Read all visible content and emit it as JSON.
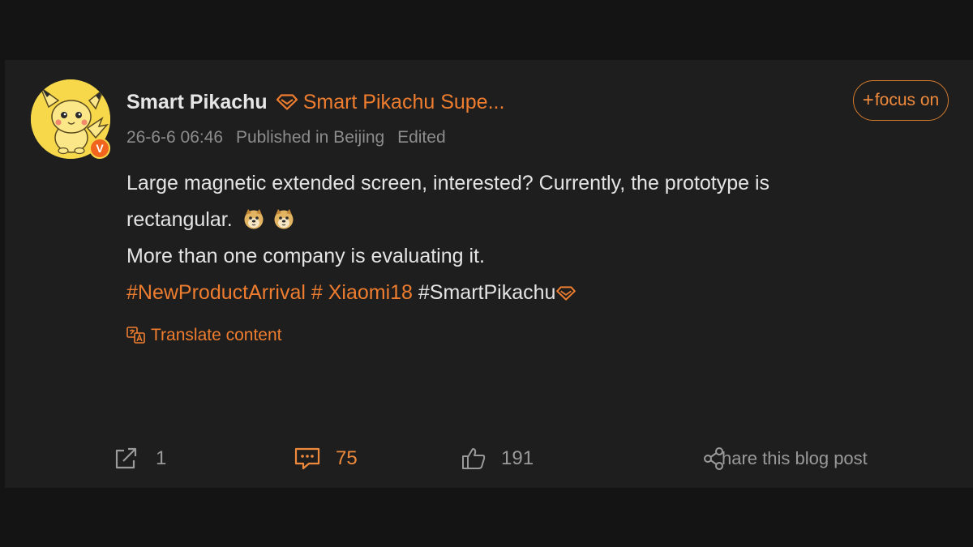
{
  "post": {
    "author": {
      "name": "Smart Pikachu",
      "badge_text": "Smart Pikachu Supe...",
      "verified_mark": "V"
    },
    "meta": {
      "date": "26-6-6 06:46",
      "location": "Published in Beijing",
      "edited": "Edited"
    },
    "follow_label": "focus on",
    "follow_plus": "+",
    "content": {
      "line1": "Large magnetic extended screen, interested? Currently, the prototype is",
      "line2": "rectangular.",
      "line3": "More than one company is evaluating it.",
      "tags": [
        {
          "text": "#NewProductArrival"
        },
        {
          "text": "# Xiaomi18"
        },
        {
          "text": "#SmartPikachu"
        }
      ]
    },
    "translate_label": "Translate content",
    "actions": {
      "repost_count": "1",
      "comment_count": "75",
      "like_count": "191",
      "share_label": "hare this blog post"
    }
  },
  "colors": {
    "background": "#141414",
    "card": "#1e1e1e",
    "accent": "#ef7d2f",
    "text": "#e4e4e4",
    "muted": "#8c8c8c"
  },
  "icons": {
    "vip": "diamond-icon",
    "translate": "translate-icon",
    "repost": "repost-icon",
    "comment": "comment-icon",
    "like": "thumbs-up-icon",
    "share": "share-icon",
    "emoji": "doge-emoji-icon"
  }
}
